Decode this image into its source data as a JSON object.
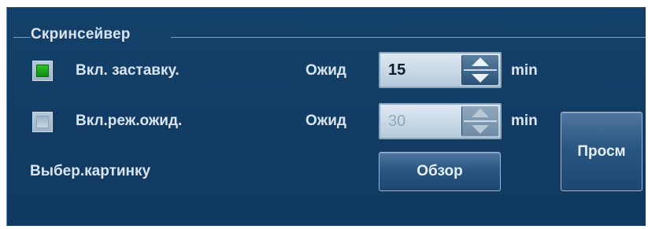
{
  "screensaver": {
    "legend": "Скринсейвер",
    "screensaver_on": {
      "label": "Вкл. заставку.",
      "checked": true,
      "wait_label": "Ожид",
      "value": "15",
      "unit": "min"
    },
    "standby_on": {
      "label": "Вкл.реж.ожид.",
      "checked": false,
      "wait_label": "Ожид",
      "value": "30",
      "unit": "min",
      "disabled": true
    },
    "choose_picture_label": "Выбер.картинку",
    "browse_button": "Обзор",
    "preview_button": "Просм"
  },
  "colors": {
    "panel_bg": "#123c64",
    "text": "#d9e4ef",
    "checked_green": "#1fa61e"
  }
}
